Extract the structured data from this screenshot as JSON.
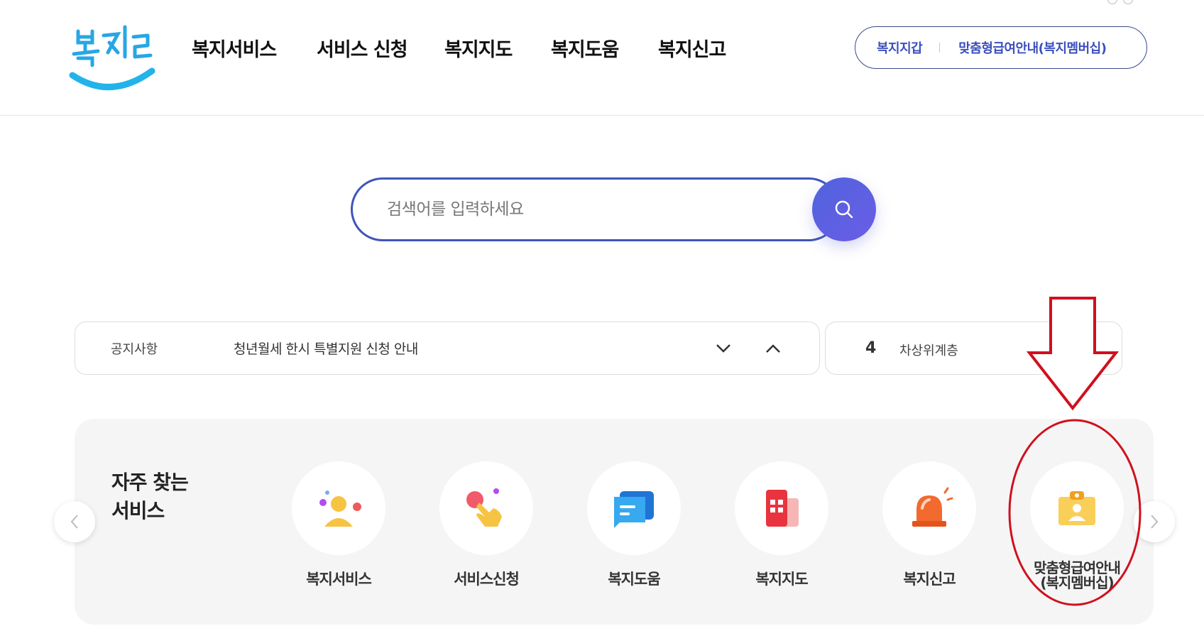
{
  "header": {
    "logo_alt": "복지로",
    "nav": [
      "복지서비스",
      "서비스 신청",
      "복지지도",
      "복지도움",
      "복지신고"
    ],
    "util": {
      "wallet": "복지지갑",
      "membership": "맞춤형급여안내(복지멤버십)"
    }
  },
  "search": {
    "placeholder": "검색어를 입력하세요"
  },
  "notice": {
    "label": "공지사항",
    "text": "청년월세 한시 특별지원 신청 안내"
  },
  "ranking": {
    "number": "4",
    "keyword": "차상위계층",
    "change": "-"
  },
  "quick": {
    "title": "자주 찾는\n서비스",
    "title_line1": "자주 찾는",
    "title_line2": "서비스",
    "items": [
      {
        "label": "복지서비스",
        "icon": "person-icon"
      },
      {
        "label": "서비스신청",
        "icon": "hand-tap-icon"
      },
      {
        "label": "복지도움",
        "icon": "chat-icon"
      },
      {
        "label": "복지지도",
        "icon": "map-building-icon"
      },
      {
        "label": "복지신고",
        "icon": "siren-icon"
      },
      {
        "label_line1": "맞춤형급여안내",
        "label_line2": "(복지멤버십)",
        "icon": "id-card-icon"
      }
    ]
  },
  "colors": {
    "brand_blue": "#3f55b9",
    "search_gradient_start": "#4f63dd",
    "search_gradient_end": "#6b5de6",
    "annotation_red": "#d0101e"
  }
}
